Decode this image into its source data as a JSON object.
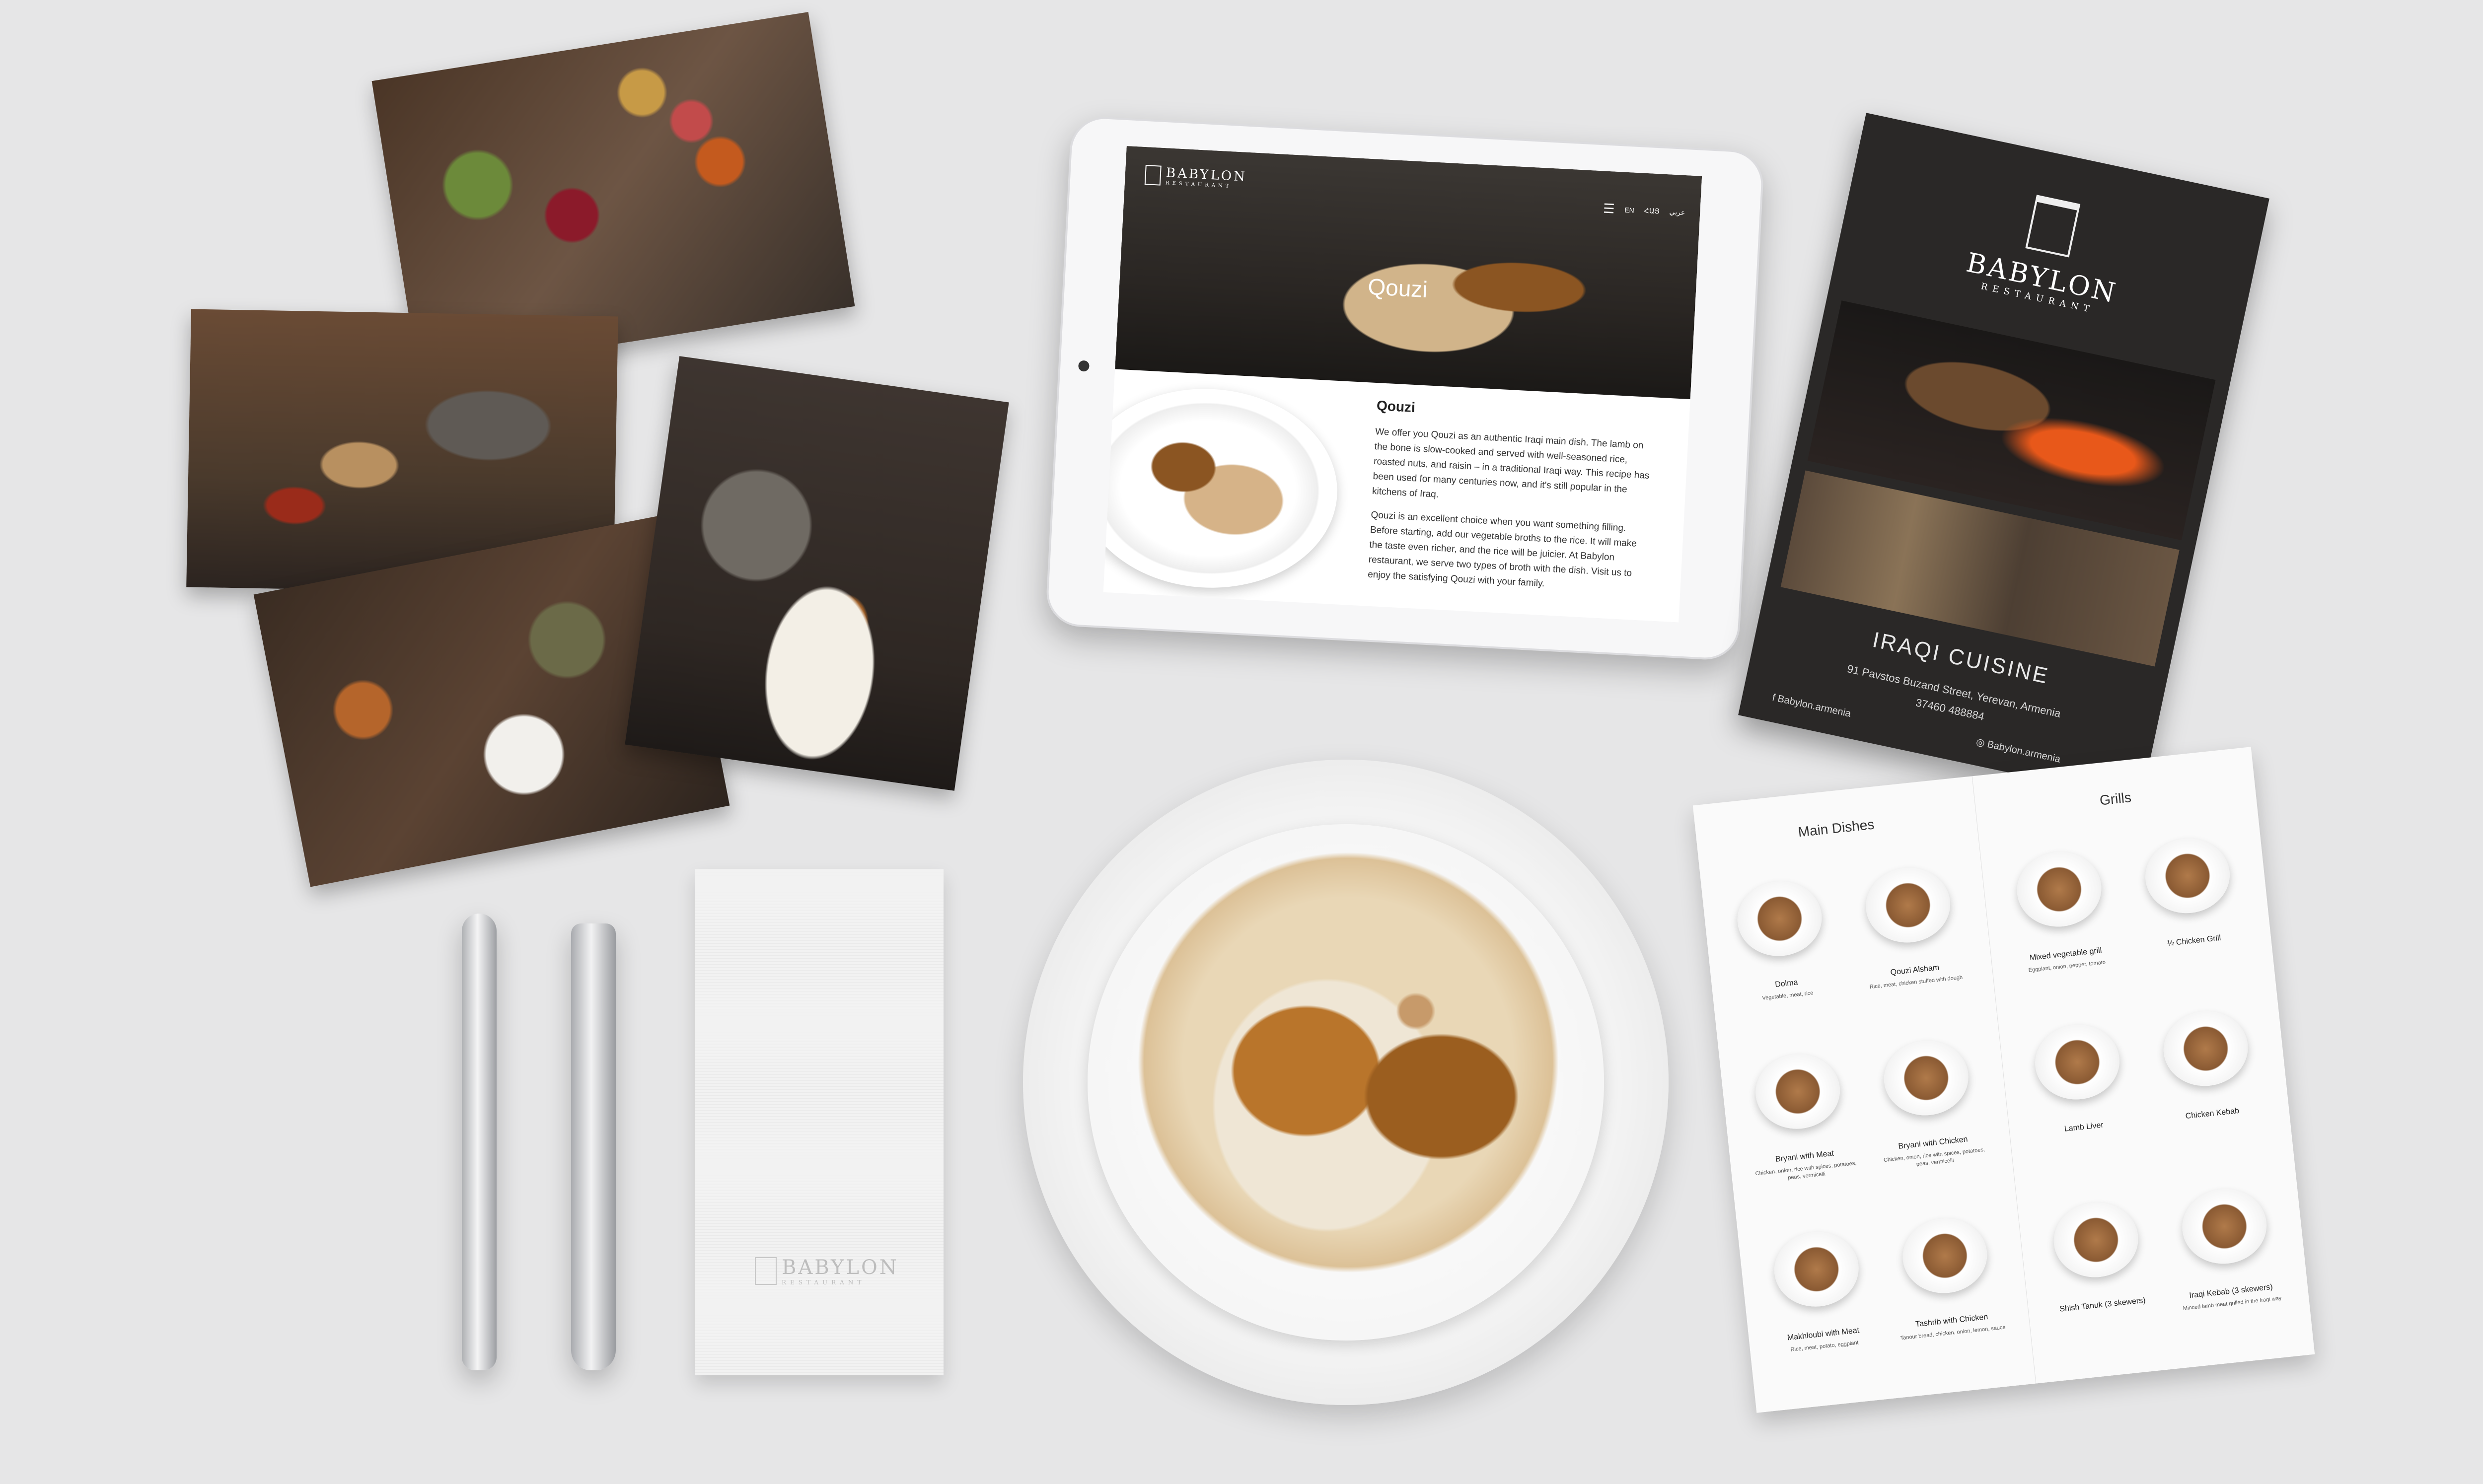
{
  "brand": {
    "name": "BABYLON",
    "tagline": "RESTAURANT"
  },
  "tablet": {
    "nav_langs": [
      "EN",
      "ՀԱՅ",
      "عربي"
    ],
    "hero_title": "Qouzi",
    "section_title": "Qouzi",
    "paragraph_1": "We offer you Qouzi as an authentic Iraqi main dish. The lamb on the bone is slow-cooked and served with well-seasoned rice, roasted nuts, and raisin – in a traditional Iraqi way. This recipe has been used for many centuries now, and it's still popular in the kitchens of Iraq.",
    "paragraph_2": "Qouzi is an excellent choice when you want something filling. Before starting, add our vegetable broths to the rice. It will make the taste even richer, and the rice will be juicier. At Babylon restaurant, we serve two types of broth with the dish. Visit us to enjoy the satisfying Qouzi with your family."
  },
  "brochure": {
    "cuisine": "IRAQI CUISINE",
    "address": "91 Pavstos Buzand Street, Yerevan, Armenia",
    "phone": "37460 488884",
    "facebook": "Babylon.armenia",
    "instagram": "Babylon.armenia"
  },
  "menu": {
    "left_title": "Main Dishes",
    "right_title": "Grills",
    "left_items": [
      {
        "name": "Dolma",
        "desc": "Vegetable, meat, rice"
      },
      {
        "name": "Qouzi Alsham",
        "desc": "Rice, meat, chicken stuffed with dough"
      },
      {
        "name": "Bryani with Meat",
        "desc": "Chicken, onion, rice with spices, potatoes, peas, vermicelli"
      },
      {
        "name": "Bryani with Chicken",
        "desc": "Chicken, onion, rice with spices, potatoes, peas, vermicelli"
      },
      {
        "name": "Makhloubi with Meat",
        "desc": "Rice, meat, potato, eggplant"
      },
      {
        "name": "Tashrib with Chicken",
        "desc": "Tanour bread, chicken, onion, lemon, sauce"
      }
    ],
    "right_items": [
      {
        "name": "Mixed vegetable grill",
        "desc": "Eggplant, onion, pepper, tomato"
      },
      {
        "name": "½ Chicken Grill",
        "desc": ""
      },
      {
        "name": "Lamb Liver",
        "desc": ""
      },
      {
        "name": "Chicken Kebab",
        "desc": ""
      },
      {
        "name": "Shish Tanuk (3 skewers)",
        "desc": ""
      },
      {
        "name": "Iraqi Kebab (3 skewers)",
        "desc": "Minced lamb meat grilled in the Iraqi way"
      }
    ]
  },
  "napkin": {
    "name": "BABYLON",
    "tagline": "RESTAURANT"
  },
  "colors": {
    "background": "#e6e6e7",
    "brochure": "#2a2827",
    "tablet_bezel": "#f7f7f8"
  }
}
